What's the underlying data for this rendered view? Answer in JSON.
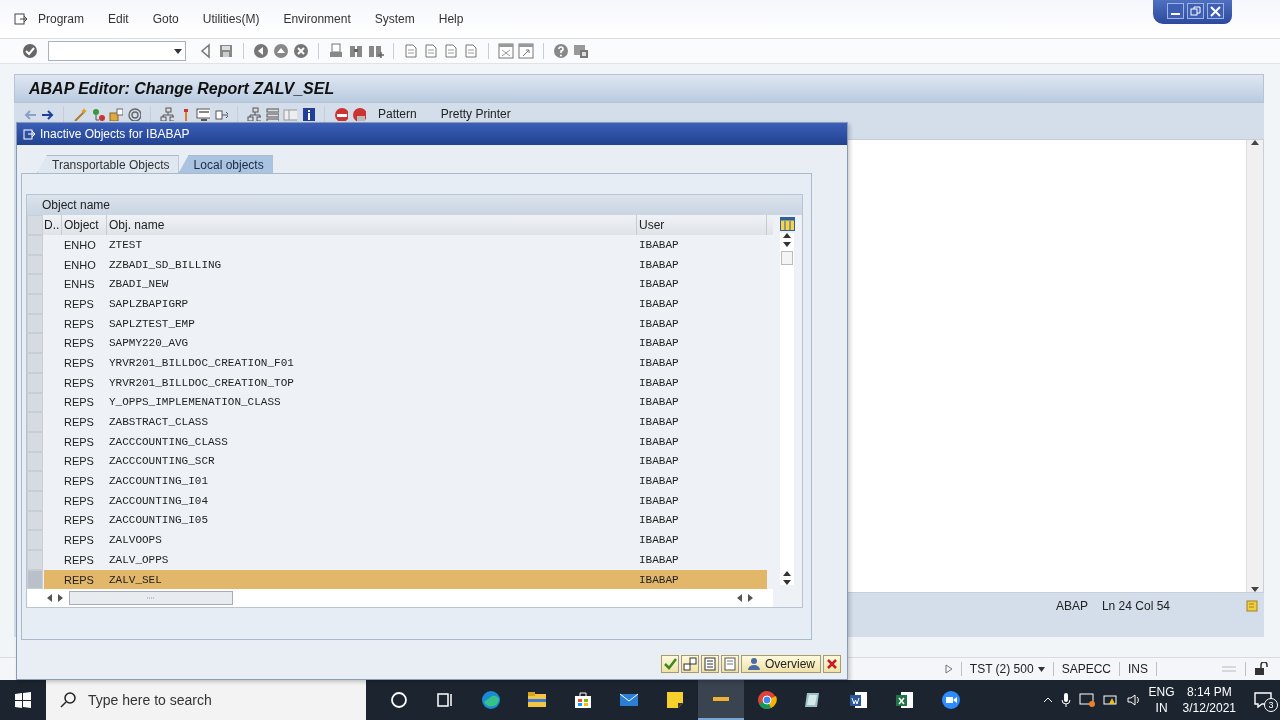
{
  "menu": [
    {
      "label": "Program"
    },
    {
      "label": "Edit"
    },
    {
      "label": "Goto"
    },
    {
      "label": "Utilities(M)"
    },
    {
      "label": "Environment"
    },
    {
      "label": "System"
    },
    {
      "label": "Help"
    }
  ],
  "screen_title": "ABAP Editor: Change Report ZALV_SEL",
  "app_toolbar": {
    "buttons": [
      "Pattern",
      "Pretty Printer"
    ]
  },
  "dialog": {
    "title": "Inactive Objects for IBABAP",
    "tabs": [
      {
        "label": "Transportable Objects",
        "selected": false
      },
      {
        "label": "Local objects",
        "selected": true
      }
    ],
    "table": {
      "heading": "Object name",
      "columns": [
        "D..",
        "Object",
        "Obj. name",
        "User"
      ],
      "rows": [
        {
          "object": "ENHO",
          "name": "ZTEST",
          "user": "IBABAP",
          "selected": false
        },
        {
          "object": "ENHO",
          "name": "ZZBADI_SD_BILLING",
          "user": "IBABAP",
          "selected": false
        },
        {
          "object": "ENHS",
          "name": "ZBADI_NEW",
          "user": "IBABAP",
          "selected": false
        },
        {
          "object": "REPS",
          "name": "SAPLZBAPIGRP",
          "user": "IBABAP",
          "selected": false
        },
        {
          "object": "REPS",
          "name": "SAPLZTEST_EMP",
          "user": "IBABAP",
          "selected": false
        },
        {
          "object": "REPS",
          "name": "SAPMY220_AVG",
          "user": "IBABAP",
          "selected": false
        },
        {
          "object": "REPS",
          "name": "YRVR201_BILLDOC_CREATION_F01",
          "user": "IBABAP",
          "selected": false
        },
        {
          "object": "REPS",
          "name": "YRVR201_BILLDOC_CREATION_TOP",
          "user": "IBABAP",
          "selected": false
        },
        {
          "object": "REPS",
          "name": "Y_OPPS_IMPLEMENATION_CLASS",
          "user": "IBABAP",
          "selected": false
        },
        {
          "object": "REPS",
          "name": "ZABSTRACT_CLASS",
          "user": "IBABAP",
          "selected": false
        },
        {
          "object": "REPS",
          "name": "ZACCCOUNTING_CLASS",
          "user": "IBABAP",
          "selected": false
        },
        {
          "object": "REPS",
          "name": "ZACCCOUNTING_SCR",
          "user": "IBABAP",
          "selected": false
        },
        {
          "object": "REPS",
          "name": "ZACCOUNTING_I01",
          "user": "IBABAP",
          "selected": false
        },
        {
          "object": "REPS",
          "name": "ZACCOUNTING_I04",
          "user": "IBABAP",
          "selected": false
        },
        {
          "object": "REPS",
          "name": "ZACCOUNTING_I05",
          "user": "IBABAP",
          "selected": false
        },
        {
          "object": "REPS",
          "name": "ZALVOOPS",
          "user": "IBABAP",
          "selected": false
        },
        {
          "object": "REPS",
          "name": "ZALV_OPPS",
          "user": "IBABAP",
          "selected": false
        },
        {
          "object": "REPS",
          "name": "ZALV_SEL",
          "user": "IBABAP",
          "selected": true
        }
      ]
    },
    "buttons": {
      "overview": "Overview"
    }
  },
  "editor_status": {
    "language": "ABAP",
    "position": "Ln  24 Col  54"
  },
  "status_bar": {
    "system": "TST (2) 500",
    "server": "SAPECC",
    "mode": "INS"
  },
  "taskbar": {
    "search": {
      "placeholder": "Type here to search"
    },
    "language": "ENG",
    "region": "IN",
    "time": "8:14 PM",
    "date": "3/12/2021",
    "notifications": "3"
  }
}
